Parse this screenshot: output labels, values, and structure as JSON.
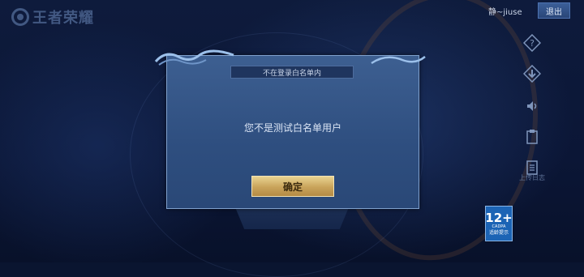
{
  "app": {
    "logo_text": "王者荣耀"
  },
  "header": {
    "username": "静~jiuse",
    "logout_label": "退出"
  },
  "sidebar": {
    "buttons": [
      {
        "icon": "question-icon",
        "glyph": "?"
      },
      {
        "icon": "download-icon",
        "glyph": "⬇"
      },
      {
        "icon": "speaker-icon",
        "glyph": "🔈"
      },
      {
        "icon": "clipboard-icon",
        "glyph": "▣"
      },
      {
        "icon": "log-icon",
        "glyph": "▤"
      }
    ],
    "log_label": "上传日志"
  },
  "dialog": {
    "title": "不在登录白名单内",
    "message": "您不是测试白名单用户",
    "confirm_label": "确定"
  },
  "age_rating": {
    "number": "12+",
    "sub": "CADPA",
    "text": "适龄提示"
  },
  "colors": {
    "accent_gold": "#c9a35a",
    "dialog_bg": "#2e4e7f"
  }
}
